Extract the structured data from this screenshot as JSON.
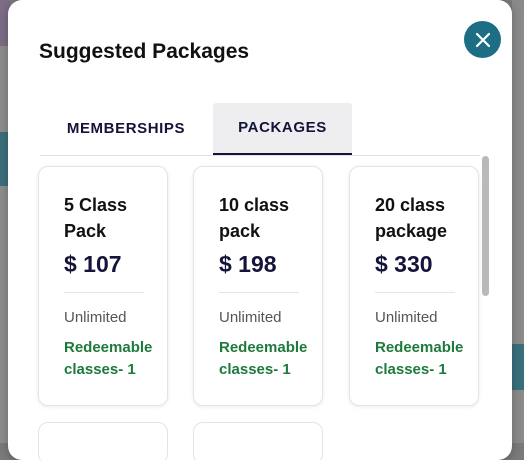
{
  "modal": {
    "title": "Suggested Packages",
    "close_icon": "close-icon",
    "accent_color": "#1d6e84"
  },
  "tabs": [
    {
      "label": "MEMBERSHIPS",
      "active": false
    },
    {
      "label": "PACKAGES",
      "active": true
    }
  ],
  "packages": [
    {
      "name": "5 Class Pack",
      "price": "$ 107",
      "validity": "Unlimited",
      "redeemable": "Redeemable classes- 1"
    },
    {
      "name": "10 class pack",
      "price": "$ 198",
      "validity": "Unlimited",
      "redeemable": "Redeemable classes- 1"
    },
    {
      "name": "20 class package",
      "price": "$ 330",
      "validity": "Unlimited",
      "redeemable": "Redeemable classes- 1"
    }
  ]
}
